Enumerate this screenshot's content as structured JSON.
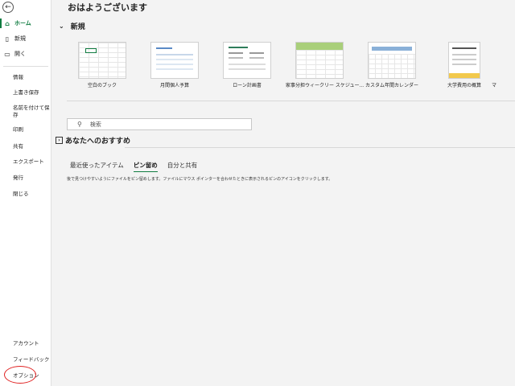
{
  "sidebar": {
    "back_glyph": "←",
    "home": "ホーム",
    "new": "新規",
    "open": "開く",
    "info": "情報",
    "save": "上書き保存",
    "save_as": "名前を付けて保存",
    "print": "印刷",
    "share": "共有",
    "export": "エクスポート",
    "publish": "発行",
    "close": "閉じる",
    "account": "アカウント",
    "feedback": "フィードバック",
    "options": "オプション"
  },
  "main": {
    "greeting": "おはようございます",
    "new_section": "新規",
    "templates": [
      {
        "label": "空白のブック"
      },
      {
        "label": "月間個人予算"
      },
      {
        "label": "ローン計画書"
      },
      {
        "label": "家事分担ウィークリー スケジュー..."
      },
      {
        "label": "カスタム年間カレンダー"
      },
      {
        "label": "大学費用の概算"
      },
      {
        "label": "マ"
      }
    ],
    "search_placeholder": "検索",
    "recommended": "あなたへのおすすめ",
    "tabs": [
      "最近使ったアイテム",
      "ピン留め",
      "自分と共有"
    ],
    "selected_tab": "ピン留め",
    "hint": "後で見つけやすいようにファイルをピン留めします。ファイルにマウス ポインターを合わせたときに表示されるピンのアイコンをクリックします。"
  },
  "colors": {
    "accent": "#107c41",
    "annotation_circle": "#e02020"
  }
}
